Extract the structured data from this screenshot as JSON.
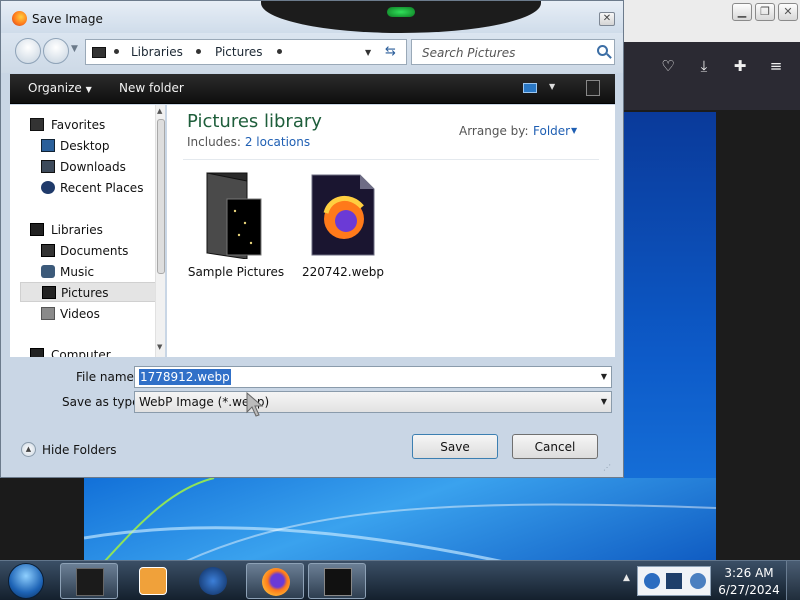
{
  "dialog": {
    "title": "Save Image",
    "close_label": "✕",
    "address": {
      "crumbs": [
        "Libraries",
        "Pictures"
      ],
      "search_placeholder": "Search Pictures"
    },
    "toolbar": {
      "organize": "Organize",
      "new_folder": "New folder"
    },
    "nav": {
      "items": [
        {
          "label": "Favorites",
          "icon": "star-icon"
        },
        {
          "label": "Desktop",
          "icon": "desktop-icon"
        },
        {
          "label": "Downloads",
          "icon": "downloads-icon"
        },
        {
          "label": "Recent Places",
          "icon": "recent-places-icon"
        },
        {
          "label": "Libraries",
          "icon": "libraries-icon"
        },
        {
          "label": "Documents",
          "icon": "documents-icon"
        },
        {
          "label": "Music",
          "icon": "music-icon"
        },
        {
          "label": "Pictures",
          "icon": "pictures-icon"
        },
        {
          "label": "Videos",
          "icon": "videos-icon"
        },
        {
          "label": "Computer",
          "icon": "computer-icon"
        }
      ],
      "selected": "Pictures"
    },
    "library": {
      "title": "Pictures library",
      "includes_label": "Includes:",
      "locations": "2 locations",
      "arrange_label": "Arrange by:",
      "arrange_value": "Folder"
    },
    "files": [
      {
        "name": "Sample Pictures",
        "icon": "folder-icon"
      },
      {
        "name": "220742.webp",
        "icon": "firefox-file-icon"
      }
    ],
    "form": {
      "file_name_label": "File name:",
      "file_name_value": "1778912.webp",
      "save_type_label": "Save as type:",
      "save_type_value": "WebP Image (*.webp)",
      "hide_folders": "Hide Folders",
      "save": "Save",
      "cancel": "Cancel"
    }
  },
  "taskbar": {
    "clock_time": "3:26 AM",
    "clock_date": "6/27/2024"
  },
  "colors": {
    "library_title": "#1e5e3b",
    "link": "#1f5fb3",
    "selection": "#3070c8"
  }
}
